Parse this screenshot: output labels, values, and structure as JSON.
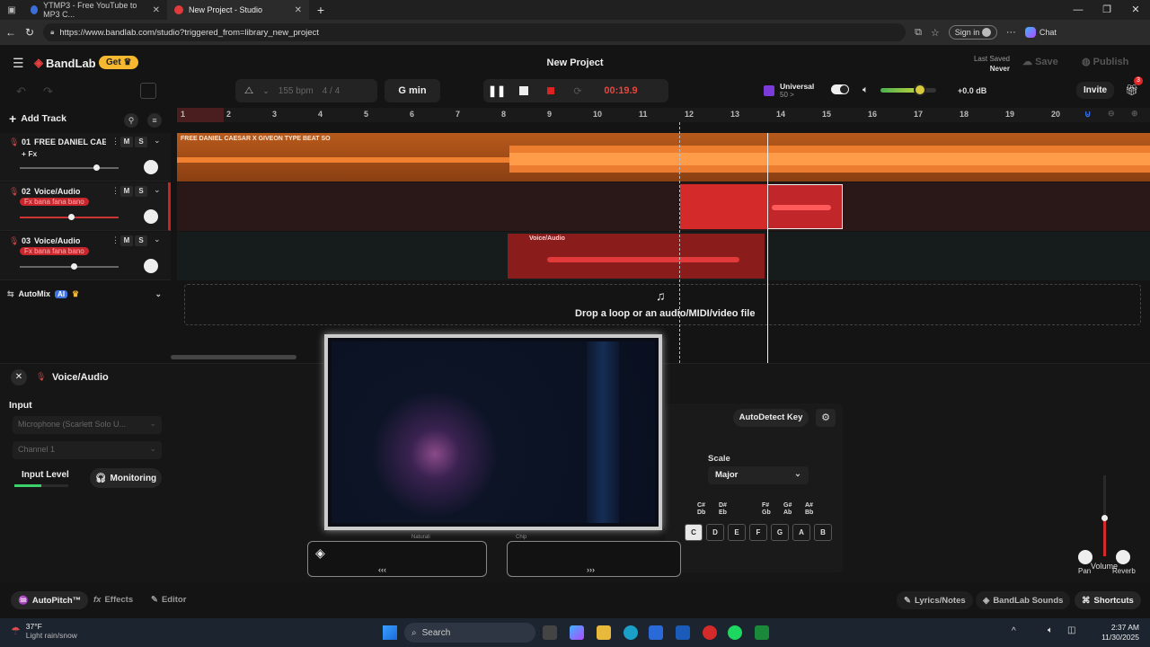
{
  "browser": {
    "tabs": [
      {
        "label": "YTMP3 - Free YouTube to MP3 C..."
      },
      {
        "label": "New Project - Studio"
      }
    ],
    "url": "https://www.bandlab.com/studio?triggered_from=library_new_project",
    "signin_label": "Sign in",
    "chat_label": "Chat"
  },
  "app": {
    "logo": "BandLab",
    "get_label": "Get",
    "project_title": "New Project",
    "last_saved_label": "Last Saved",
    "last_saved_value": "Never",
    "save_label": "Save",
    "publish_label": "Publish",
    "invite_label": "Invite",
    "gift_badge": "3"
  },
  "transport": {
    "bpm": "155 bpm",
    "time_sig": "4 / 4",
    "key": "G min",
    "time": "00:19.9",
    "universal_label": "Universal",
    "universal_sub": "50 >",
    "master_level": "+0.0 dB",
    "master_level_fraction": 0.74
  },
  "toolbar": {
    "add_track_label": "Add Track"
  },
  "ruler": {
    "marks": [
      "1",
      "2",
      "3",
      "4",
      "5",
      "6",
      "7",
      "8",
      "9",
      "10",
      "11",
      "12",
      "13",
      "14",
      "15",
      "16",
      "17",
      "18",
      "19",
      "20"
    ]
  },
  "tracks": [
    {
      "number": "01",
      "name": "FREE DANIEL CAES...",
      "fx": "+ Fx",
      "volume": 0.8,
      "clip_label": "FREE DANIEL CAESAR X GIVEON TYPE BEAT SO"
    },
    {
      "number": "02",
      "name": "Voice/Audio",
      "fx": "Fx bana fana bano",
      "volume": 0.55
    },
    {
      "number": "03",
      "name": "Voice/Audio",
      "fx": "Fx bana fana bano",
      "volume": 0.58,
      "clip_label": "Voice/Audio"
    }
  ],
  "automix": {
    "label": "AutoMix",
    "badge": "AI"
  },
  "dropzone": {
    "text": "Drop a loop or an audio/MIDI/video file"
  },
  "editor": {
    "title": "Voice/Audio",
    "input_label": "Input",
    "input_device": "Microphone (Scarlett Solo U...",
    "channel": "Channel 1",
    "input_level_label": "Input Level",
    "monitoring_label": "Monitoring",
    "autodetect_label": "AutoDetect Key",
    "scale_label": "Scale",
    "scale_value": "Major",
    "sharps": [
      "C#\nDb",
      "D#\nEb",
      "F#\nGb",
      "G#\nAb",
      "A#\nBb"
    ],
    "keys": [
      "C",
      "D",
      "E",
      "F",
      "G",
      "A",
      "B"
    ],
    "volume_label": "Volume",
    "volume_level": 0.42,
    "pan_label": "Pan",
    "reverb_label": "Reverb",
    "overlay_labels": [
      "Naturali",
      "Chip"
    ]
  },
  "bottombar": {
    "autopitch_label": "AutoPitch™",
    "effects_label": "Effects",
    "editor_label": "Editor",
    "lyrics_label": "Lyrics/Notes",
    "sounds_label": "BandLab Sounds",
    "shortcuts_label": "Shortcuts"
  },
  "taskbar": {
    "weather_temp": "37°F",
    "weather_desc": "Light rain/snow",
    "search_label": "Search",
    "time": "2:37 AM",
    "date": "11/30/2025"
  },
  "colors": {
    "accent_orange": "#e87722",
    "accent_red": "#d42a2a",
    "brand_yellow": "#f5b82e"
  }
}
